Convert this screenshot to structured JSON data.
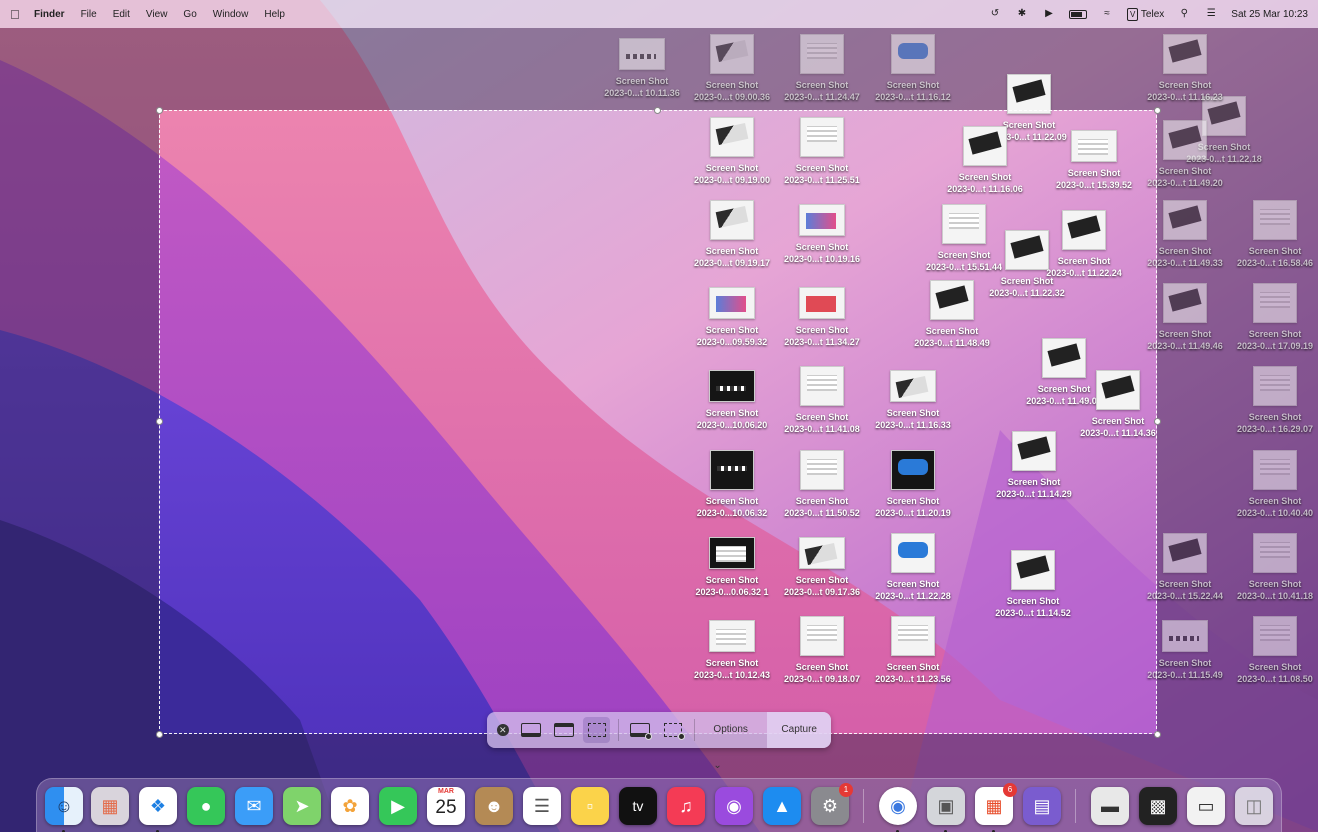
{
  "menubar": {
    "app": "Finder",
    "menus": [
      "File",
      "Edit",
      "View",
      "Go",
      "Window",
      "Help"
    ],
    "input_source": "Telex",
    "datetime": "Sat 25 Mar  10:23"
  },
  "toolbar": {
    "options_label": "Options",
    "capture_label": "Capture"
  },
  "dock": {
    "calendar_month": "MAR",
    "calendar_day": "25",
    "settings_badge": "1",
    "office_badge": "6",
    "tv_label": "tv"
  },
  "icons": [
    {
      "name": "Screen Shot",
      "date": "2023-0...t 10.11.36"
    },
    {
      "name": "Screen Shot",
      "date": "2023-0...t 09.00.36"
    },
    {
      "name": "Screen Shot",
      "date": "2023-0...t 11.24.47"
    },
    {
      "name": "Screen Shot",
      "date": "2023-0...t 11.16.12"
    },
    {
      "name": "Screen Shot",
      "date": "2023-0...t 11.22.09"
    },
    {
      "name": "Screen Shot",
      "date": "2023-0...t 09.19.00"
    },
    {
      "name": "Screen Shot",
      "date": "2023-0...t 11.25.51"
    },
    {
      "name": "Screen Shot",
      "date": "2023-0...t 11.16.06"
    },
    {
      "name": "Screen Shot",
      "date": "2023-0...t 15.39.52"
    },
    {
      "name": "Screen Shot",
      "date": "2023-0...t 09.19.17"
    },
    {
      "name": "Screen Shot",
      "date": "2023-0...t 10.19.16"
    },
    {
      "name": "Screen Shot",
      "date": "2023-0...t 15.51.44"
    },
    {
      "name": "Screen Shot",
      "date": "2023-0...t 11.22.32"
    },
    {
      "name": "Screen Shot",
      "date": "2023-0...t 11.22.24"
    },
    {
      "name": "Screen Shot",
      "date": "2023-0...09.59.32"
    },
    {
      "name": "Screen Shot",
      "date": "2023-0...t 11.34.27"
    },
    {
      "name": "Screen Shot",
      "date": "2023-0...t 11.48.49"
    },
    {
      "name": "Screen Shot",
      "date": "2023-0...10.06.20"
    },
    {
      "name": "Screen Shot",
      "date": "2023-0...t 11.41.08"
    },
    {
      "name": "Screen Shot",
      "date": "2023-0...t 11.16.33"
    },
    {
      "name": "Screen Shot",
      "date": "2023-0...t 11.49.00"
    },
    {
      "name": "Screen Shot",
      "date": "2023-0...t 11.14.36"
    },
    {
      "name": "Screen Shot",
      "date": "2023-0...10.06.32"
    },
    {
      "name": "Screen Shot",
      "date": "2023-0...t 11.50.52"
    },
    {
      "name": "Screen Shot",
      "date": "2023-0...t 11.20.19"
    },
    {
      "name": "Screen Shot",
      "date": "2023-0...t 11.14.29"
    },
    {
      "name": "Screen Shot",
      "date": "2023-0...0.06.32 1"
    },
    {
      "name": "Screen Shot",
      "date": "2023-0...t 09.17.36"
    },
    {
      "name": "Screen Shot",
      "date": "2023-0...t 11.22.28"
    },
    {
      "name": "Screen Shot",
      "date": "2023-0...t 11.14.52"
    },
    {
      "name": "Screen Shot",
      "date": "2023-0...t 10.12.43"
    },
    {
      "name": "Screen Shot",
      "date": "2023-0...t 09.18.07"
    },
    {
      "name": "Screen Shot",
      "date": "2023-0...t 11.23.56"
    },
    {
      "name": "Screen Shot",
      "date": "2023-0...t 11.22.18"
    },
    {
      "name": "Screen Shot",
      "date": "2023-0...t 11.49.20"
    },
    {
      "name": "Screen Shot",
      "date": "2023-0...t 11.49.33"
    },
    {
      "name": "Screen Shot",
      "date": "2023-0...t 16.58.46"
    },
    {
      "name": "Screen Shot",
      "date": "2023-0...t 11.49.46"
    },
    {
      "name": "Screen Shot",
      "date": "2023-0...t 17.09.19"
    },
    {
      "name": "Screen Shot",
      "date": "2023-0...t 16.29.07"
    },
    {
      "name": "Screen Shot",
      "date": "2023-0...t 10.40.40"
    },
    {
      "name": "Screen Shot",
      "date": "2023-0...t 15.22.44"
    },
    {
      "name": "Screen Shot",
      "date": "2023-0...t 10.41.18"
    },
    {
      "name": "Screen Shot",
      "date": "2023-0...t 11.15.49"
    },
    {
      "name": "Screen Shot",
      "date": "2023-0...t 11.08.50"
    },
    {
      "name": "Screen Shot",
      "date": "2023-0...t 11.16.23"
    }
  ]
}
